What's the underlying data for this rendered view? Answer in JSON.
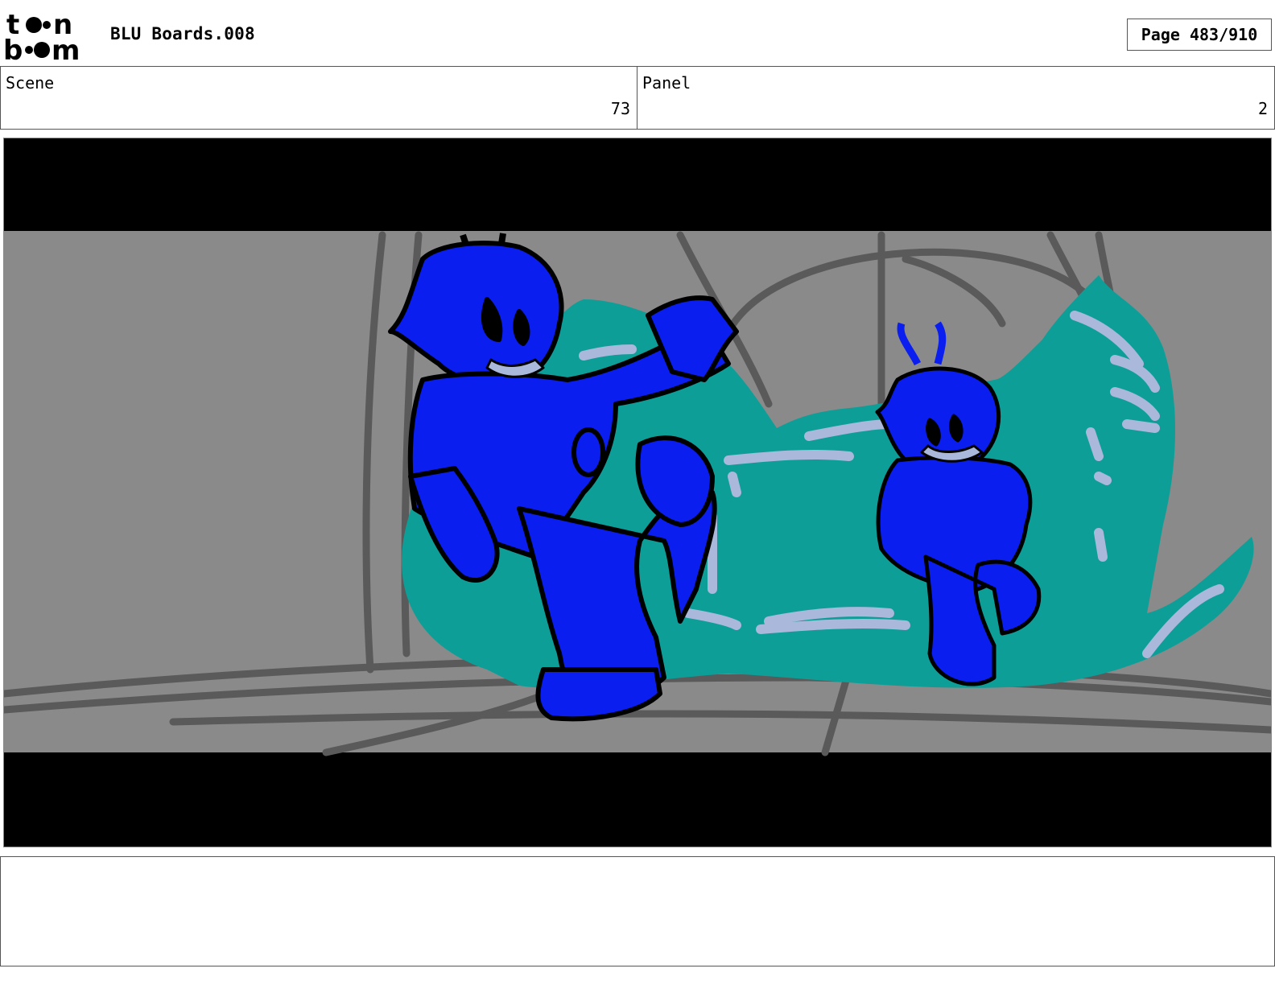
{
  "header": {
    "logo_text": "toon boom",
    "project_title": "BLU Boards.008",
    "page_indicator": "Page 483/910"
  },
  "info": {
    "scene_label": "Scene",
    "scene_value": "73",
    "panel_label": "Panel",
    "panel_value": "2"
  },
  "notes": {
    "text": ""
  },
  "colors": {
    "background_gray": "#8a8a8a",
    "slime_teal": "#0e9e98",
    "character_blue": "#0a1ef0",
    "highlight": "#aab8dc",
    "letterbox": "#000000"
  }
}
